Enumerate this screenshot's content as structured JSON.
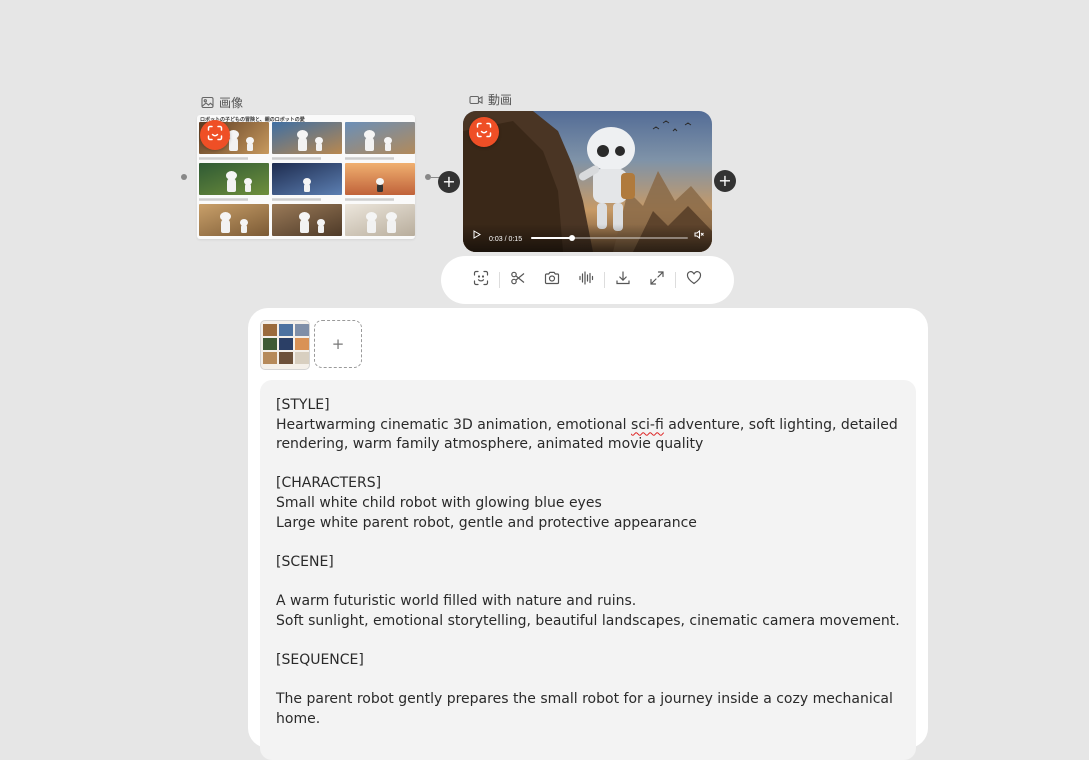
{
  "image_node": {
    "label": "画像",
    "sheet_title": "ロボットの子どもの冒険と、親のロボットの愛"
  },
  "video_node": {
    "label": "動画",
    "time": "0:03 / 0:15",
    "progress": 0.26
  },
  "toolbar": {
    "items": [
      "face-scan",
      "scissors",
      "camera",
      "audio-wave",
      "download",
      "expand",
      "heart"
    ]
  },
  "panel": {
    "add_label": "+",
    "prompt": {
      "before": "[STYLE]\nHeartwarming cinematic 3D animation, emotional ",
      "flagged": "sci-fi",
      "after": " adventure, soft lighting, detailed rendering, warm family atmosphere, animated movie quality\n\n[CHARACTERS]\nSmall white child robot with glowing blue eyes\nLarge white parent robot, gentle and protective appearance\n\n[SCENE]\n\nA warm futuristic world filled with nature and ruins.\nSoft sunlight, emotional storytelling, beautiful landscapes, cinematic camera movement.\n\n[SEQUENCE]\n\nThe parent robot gently prepares the small robot for a journey inside a cozy mechanical home."
    }
  },
  "colors": {
    "accent": "#ef4f26",
    "canvas": "#e6e6e6",
    "panel": "#ffffff",
    "prompt_bg": "#f3f3f3"
  }
}
